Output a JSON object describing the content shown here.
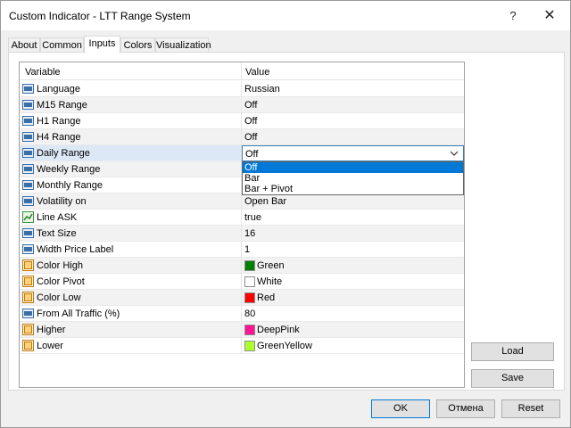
{
  "window": {
    "title": "Custom Indicator - LTT Range System",
    "help_glyph": "?",
    "close_glyph": "✕"
  },
  "tabs": [
    {
      "label": "About",
      "active": false
    },
    {
      "label": "Common",
      "active": false
    },
    {
      "label": "Inputs",
      "active": true
    },
    {
      "label": "Colors",
      "active": false
    },
    {
      "label": "Visualization",
      "active": false
    }
  ],
  "grid": {
    "columns": {
      "variable": "Variable",
      "value": "Value"
    },
    "rows": [
      {
        "icon": "numeric-icon",
        "label": "Language",
        "value": "Russian"
      },
      {
        "icon": "numeric-icon",
        "label": "M15 Range",
        "value": "Off"
      },
      {
        "icon": "numeric-icon",
        "label": "H1 Range",
        "value": "Off"
      },
      {
        "icon": "numeric-icon",
        "label": "H4 Range",
        "value": "Off"
      },
      {
        "icon": "numeric-icon",
        "label": "Daily Range",
        "value": "Off",
        "editing": true
      },
      {
        "icon": "numeric-icon",
        "label": "Weekly Range",
        "value": ""
      },
      {
        "icon": "numeric-icon",
        "label": "Monthly Range",
        "value": ""
      },
      {
        "icon": "numeric-icon",
        "label": "Volatility on",
        "value": "Open Bar"
      },
      {
        "icon": "line-icon",
        "label": "Line ASK",
        "value": "true"
      },
      {
        "icon": "numeric-icon",
        "label": "Text Size",
        "value": "16"
      },
      {
        "icon": "numeric-icon",
        "label": "Width Price Label",
        "value": "1"
      },
      {
        "icon": "color-icon",
        "label": "Color High",
        "value": "Green",
        "swatch": "#007f00"
      },
      {
        "icon": "color-icon",
        "label": "Color Pivot",
        "value": "White",
        "swatch": "#ffffff"
      },
      {
        "icon": "color-icon",
        "label": "Color Low",
        "value": "Red",
        "swatch": "#ff0000"
      },
      {
        "icon": "numeric-icon",
        "label": "From All Traffic (%)",
        "value": "80"
      },
      {
        "icon": "color-icon",
        "label": "Higher",
        "value": "DeepPink",
        "swatch": "#ff1493"
      },
      {
        "icon": "color-icon",
        "label": "Lower",
        "value": "GreenYellow",
        "swatch": "#adff2f"
      }
    ]
  },
  "dropdown": {
    "options": [
      "Off",
      "Bar",
      "Bar + Pivot"
    ],
    "selected_index": 0
  },
  "buttons": {
    "load": "Load",
    "save": "Save",
    "ok": "OK",
    "cancel": "Отмена",
    "reset": "Reset"
  },
  "colors": {
    "selection_blue": "#0078d7",
    "row_highlight": "#dce8f5"
  }
}
